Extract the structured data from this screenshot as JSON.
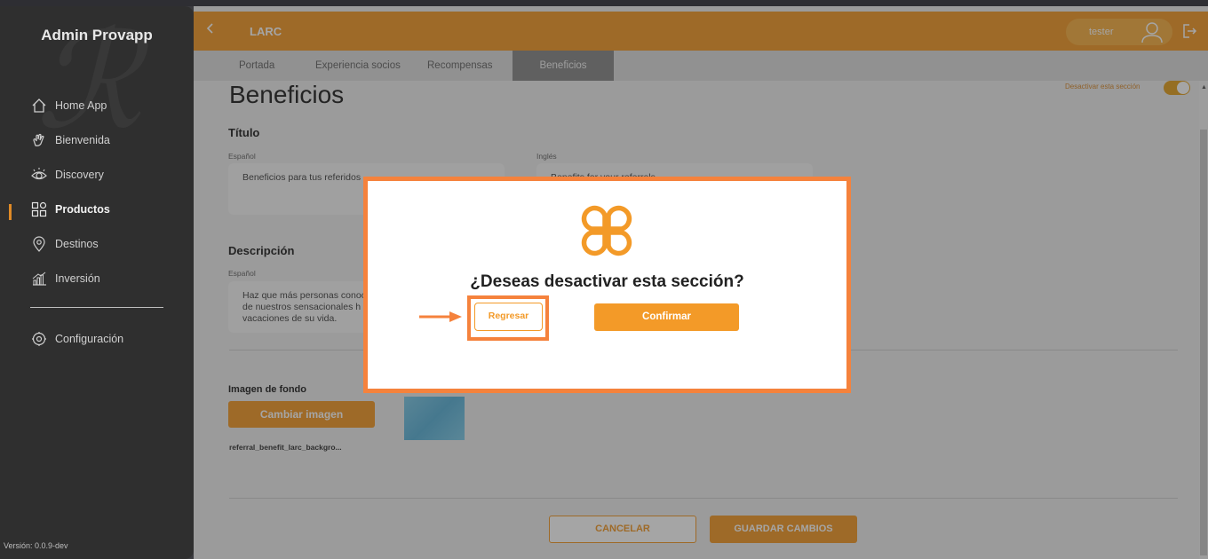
{
  "sidebar": {
    "brand": "Admin Provapp",
    "items": [
      {
        "label": "Home App",
        "icon": "home-icon"
      },
      {
        "label": "Bienvenida",
        "icon": "wave-hand-icon"
      },
      {
        "label": "Discovery",
        "icon": "eye-icon"
      },
      {
        "label": "Productos",
        "icon": "grid-icon",
        "active": true
      },
      {
        "label": "Destinos",
        "icon": "location-pin-icon"
      },
      {
        "label": "Inversión",
        "icon": "bar-chart-icon"
      }
    ],
    "settings_label": "Configuración",
    "version": "Versión: 0.0.9-dev"
  },
  "header": {
    "title": "LARC",
    "user": "tester"
  },
  "tabs": [
    "Portada",
    "Experiencia socios",
    "Recompensas",
    "Beneficios"
  ],
  "page": {
    "title": "Beneficios",
    "toggle_label": "Desactivar esta sección",
    "titulo_heading": "Título",
    "espanol_label": "Español",
    "ingles_label": "Inglés",
    "titulo_es": "Beneficios para tus referidos",
    "titulo_en": "Benefits for your referrals",
    "descripcion_heading": "Descripción",
    "descripcion_es_label": "Español",
    "descripcion_es": "Haz que más personas conoc\nde nuestros sensacionales h\nvacaciones de su vida.",
    "imagen_heading": "Imagen de fondo",
    "cambiar_imagen": "Cambiar imagen",
    "filename": "referral_benefit_larc_backgro...",
    "cancel": "CANCELAR",
    "save": "GUARDAR CAMBIOS"
  },
  "modal": {
    "question": "¿Deseas desactivar esta sección?",
    "back": "Regresar",
    "confirm": "Confirmar"
  },
  "colors": {
    "accent": "#f39a28",
    "highlight": "#f5823c",
    "sidebar": "#2f2f2f"
  }
}
